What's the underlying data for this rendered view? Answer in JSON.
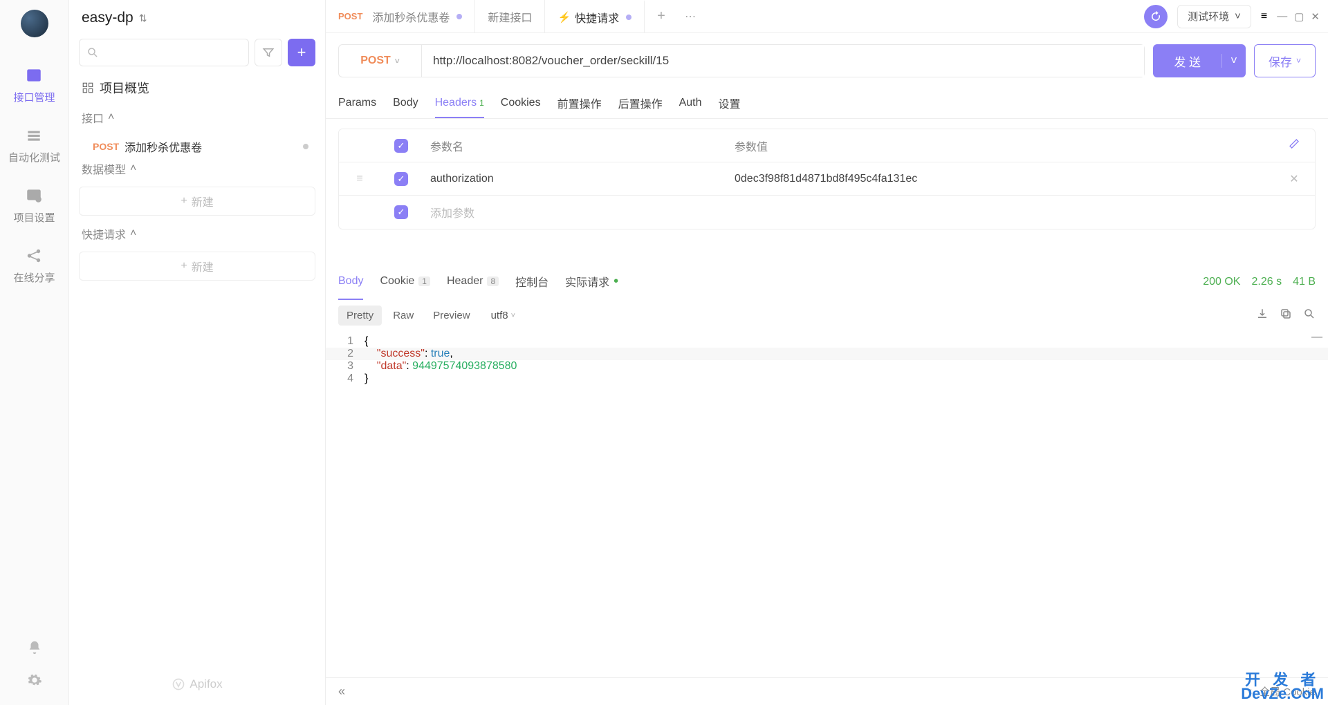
{
  "project": {
    "name": "easy-dp"
  },
  "rail": {
    "items": [
      "接口管理",
      "自动化测试",
      "项目设置",
      "在线分享"
    ]
  },
  "sidebar": {
    "overview": "项目概览",
    "sections": {
      "api": "接口",
      "model": "数据模型",
      "quick": "快捷请求"
    },
    "new_btn": "新建",
    "api_item": {
      "method": "POST",
      "name": "添加秒杀优惠卷"
    },
    "brand": "Apifox"
  },
  "tabs": [
    {
      "method": "POST",
      "label": "添加秒杀优惠卷",
      "modified": true
    },
    {
      "label": "新建接口"
    },
    {
      "icon": "⚡",
      "label": "快捷请求",
      "modified": true,
      "active": true
    }
  ],
  "env": {
    "label": "测试环境"
  },
  "request": {
    "method": "POST",
    "url": "http://localhost:8082/voucher_order/seckill/15",
    "send": "发 送",
    "save": "保存",
    "tabs": [
      "Params",
      "Body",
      "Headers",
      "Cookies",
      "前置操作",
      "后置操作",
      "Auth",
      "设置"
    ],
    "headers_count": "1",
    "table": {
      "name_header": "参数名",
      "value_header": "参数值",
      "rows": [
        {
          "name": "authorization",
          "value": "0dec3f98f81d4871bd8f495c4fa131ec"
        }
      ],
      "placeholder": "添加参数"
    }
  },
  "response": {
    "tabs": {
      "body": "Body",
      "cookie": "Cookie",
      "cookie_n": "1",
      "header": "Header",
      "header_n": "8",
      "console": "控制台",
      "actual": "实际请求"
    },
    "stats": {
      "status": "200 OK",
      "time": "2.26 s",
      "size": "41 B"
    },
    "toolbar": {
      "pretty": "Pretty",
      "raw": "Raw",
      "preview": "Preview",
      "enc": "utf8"
    },
    "body_json": {
      "success": true,
      "data": 94497574093878577
    }
  },
  "footer": {
    "cookie": "全局 Cookie"
  },
  "watermark": {
    "top": "开 发 者",
    "bottom": "DevZe.CoM"
  }
}
